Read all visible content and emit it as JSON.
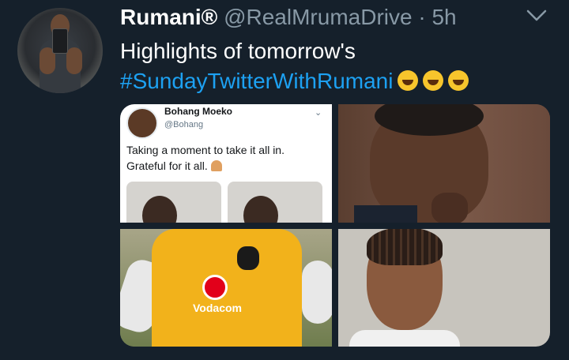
{
  "tweet": {
    "display_name": "Rumani®",
    "handle": "@RealMrumaDrive",
    "separator": "·",
    "time": "5h",
    "text_line1": "Highlights of tomorrow's",
    "hashtag": "#SundayTwitterWithRumani",
    "emoji_count": 3
  },
  "media": {
    "embedded_tweet": {
      "display_name": "Bohang Moeko",
      "handle": "@Bohang",
      "text_line1": "Taking a moment to take it all in.",
      "text_line2": "Grateful for it all."
    },
    "jersey_sponsor": "Vodacom"
  },
  "colors": {
    "background": "#15202b",
    "text": "#ffffff",
    "secondary": "#8899a6",
    "link": "#1da1f2"
  },
  "icons": [
    "chevron-down-icon",
    "rolling-laughing-emoji"
  ]
}
